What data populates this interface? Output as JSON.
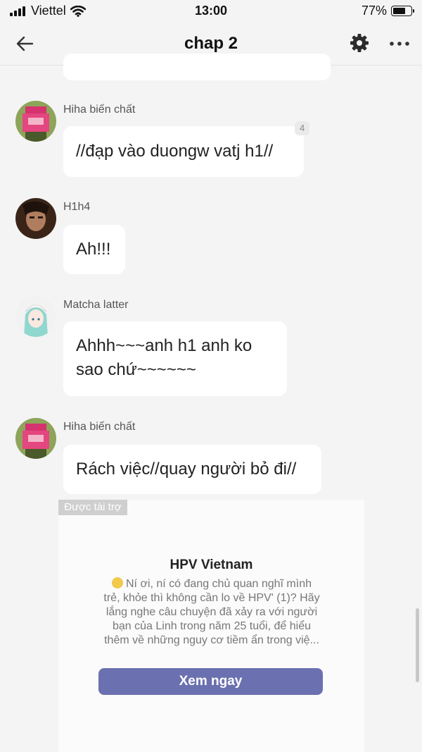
{
  "status_bar": {
    "carrier": "Viettel",
    "time": "13:00",
    "battery_percent": "77%",
    "battery_level": 0.77
  },
  "header": {
    "title": "chap 2",
    "icons": [
      "back-arrow-icon",
      "gear-icon",
      "more-icon"
    ]
  },
  "messages": [
    {
      "sender": "Hiha biến chất",
      "text": "//đạp vào duongw vatj h1//",
      "reply_count": "4"
    },
    {
      "sender": "H1h4",
      "text": "Ah!!!"
    },
    {
      "sender": "Matcha latter",
      "text_line1": "Ahhh~~~anh h1 anh ko",
      "text_line2": "sao chứ~~~~~~"
    },
    {
      "sender": "Hiha biến chất",
      "text": "Rách việc//quay người bỏ đi//"
    }
  ],
  "ad": {
    "label": "Được tài trợ",
    "title": "HPV Vietnam",
    "body_lines": [
      "Ní ơi, ní có đang chủ quan nghĩ mình",
      "trẻ, khỏe thì không cần lo về HPV' (1)? Hãy",
      "lắng nghe câu chuyện đã xảy ra với người",
      "bạn của Linh trong năm 25 tuổi, để hiểu",
      "thêm về những nguy cơ tiềm ẩn trong việ..."
    ],
    "cta": "Xem ngay",
    "cta_color": "#6b70b0"
  }
}
